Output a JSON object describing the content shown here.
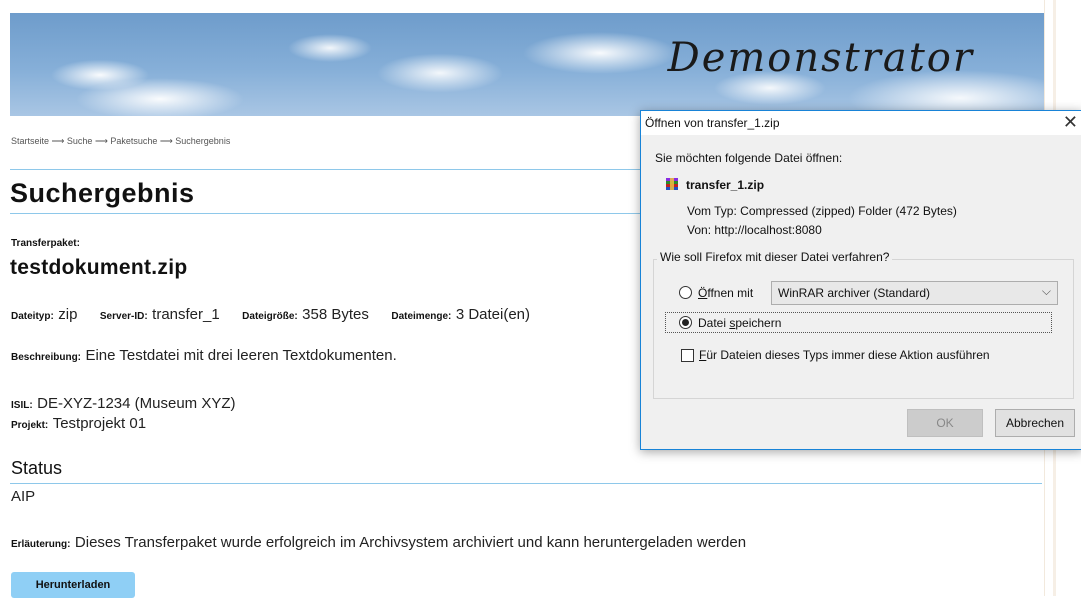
{
  "banner": {
    "title": "Demonstrator"
  },
  "breadcrumb": {
    "text": "Startseite ⟶ Suche ⟶ Paketsuche ⟶ Suchergebnis"
  },
  "page": {
    "title": "Suchergebnis"
  },
  "transfer": {
    "label": "Transferpaket:",
    "name": "testdokument.zip",
    "filetype_label": "Dateityp:",
    "filetype_value": "zip",
    "server_label": "Server-ID:",
    "server_value": "transfer_1",
    "size_label": "Dateigröße:",
    "size_value": "358 Bytes",
    "count_label": "Dateimenge:",
    "count_value": "3 Datei(en)",
    "desc_label": "Beschreibung:",
    "desc_value": "Eine Testdatei mit drei leeren Textdokumenten.",
    "isil_label": "ISIL:",
    "isil_value": "DE-XYZ-1234 (Museum XYZ)",
    "project_label": "Projekt:",
    "project_value": "Testprojekt 01"
  },
  "status": {
    "heading": "Status",
    "value": "AIP",
    "explanation_label": "Erläuterung:",
    "explanation_value": "Dieses Transferpaket wurde erfolgreich im Archivsystem archiviert und kann heruntergeladen werden"
  },
  "download_button": "Herunterladen",
  "dialog": {
    "title": "Öffnen von transfer_1.zip",
    "close_glyph": "✕",
    "intro": "Sie möchten folgende Datei öffnen:",
    "filename": "transfer_1.zip",
    "type_label": "Vom Typ:",
    "type_value": "Compressed (zipped) Folder (472 Bytes)",
    "from_label": "Von:",
    "from_value": "http://localhost:8080",
    "group_label": "Wie soll Firefox mit dieser Datei verfahren?",
    "open_with_prefix": "Ö",
    "open_with_rest": "ffnen mit",
    "open_with_app": "WinRAR archiver (Standard)",
    "save_prefix": "Datei ",
    "save_underline": "s",
    "save_rest": "peichern",
    "always_prefix": "F",
    "always_rest": "ür Dateien dieses Typs immer diese Aktion ausführen",
    "ok": "OK",
    "cancel": "Abbrechen",
    "selected_option": "save"
  }
}
